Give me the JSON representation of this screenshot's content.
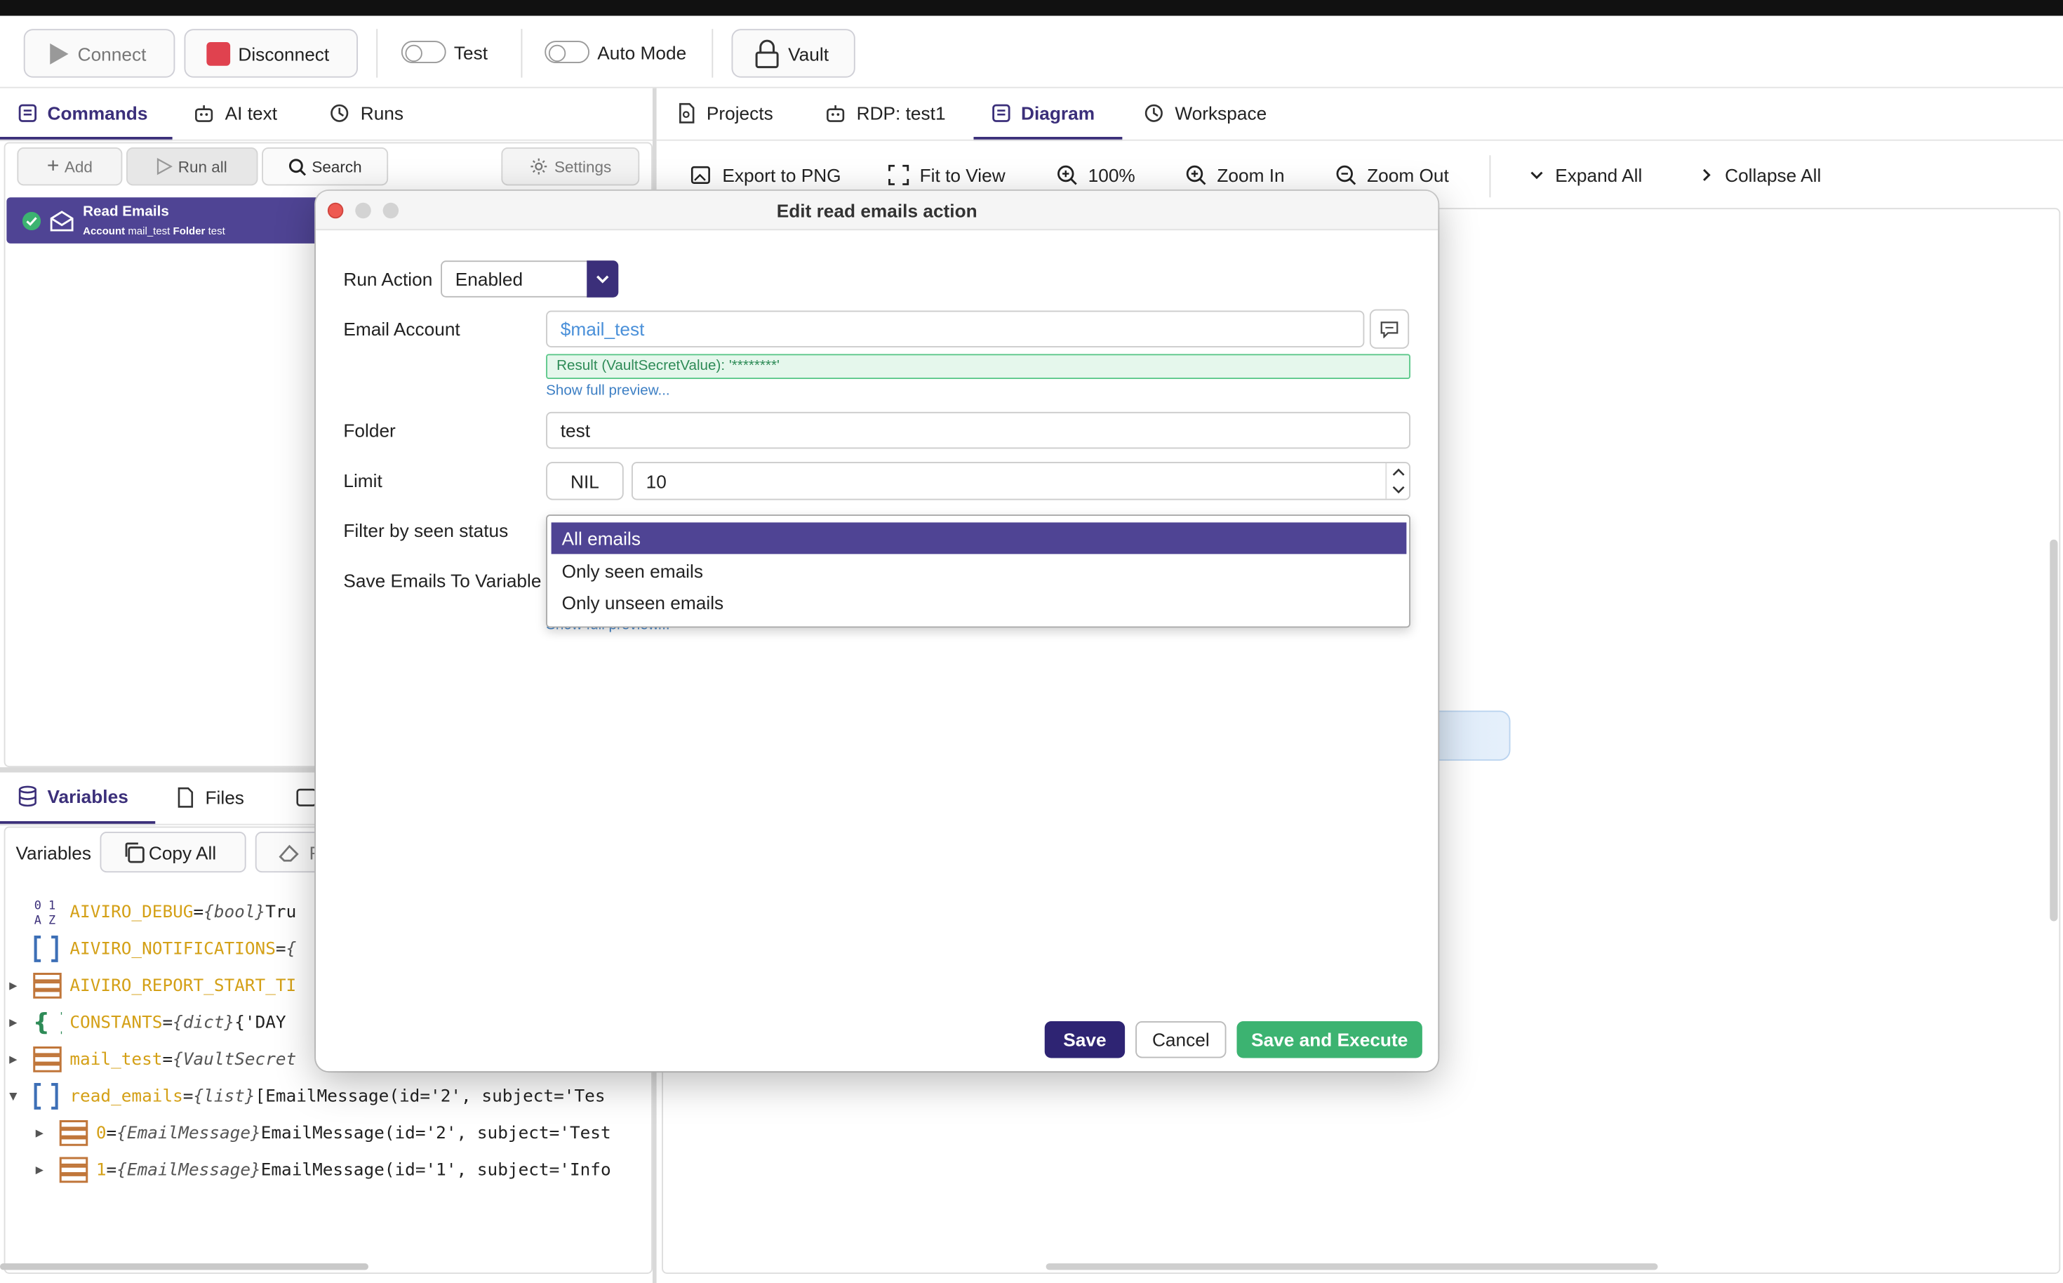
{
  "toolbar": {
    "connect": "Connect",
    "disconnect": "Disconnect",
    "test": "Test",
    "auto_mode": "Auto Mode",
    "vault": "Vault"
  },
  "left_tabs": {
    "commands": "Commands",
    "ai_text": "AI text",
    "runs": "Runs"
  },
  "commands_toolbar": {
    "add": "Add",
    "run_all": "Run all",
    "search": "Search",
    "settings": "Settings"
  },
  "command_item": {
    "title": "Read Emails",
    "account_key": "Account",
    "account_value": "mail_test",
    "folder_key": "Folder",
    "folder_value": "test"
  },
  "bottom_tabs": {
    "variables": "Variables",
    "files": "Files"
  },
  "variables_toolbar": {
    "label": "Variables",
    "copy_all": "Copy All",
    "reset_partial": "R"
  },
  "variables": [
    {
      "name": "AIVIRO_DEBUG",
      "eq": " = ",
      "type": "{bool}",
      "value": " Tru",
      "icon": "bool-icon"
    },
    {
      "name": "AIVIRO_NOTIFICATIONS",
      "eq": " = ",
      "type": "{",
      "value": "",
      "icon": "list-icon"
    },
    {
      "name": "AIVIRO_REPORT_START_TI",
      "eq": "",
      "type": "",
      "value": "",
      "icon": "object-icon"
    },
    {
      "name": "CONSTANTS",
      "eq": " = ",
      "type": "{dict}",
      "value": " {'DAY",
      "icon": "dict-icon"
    },
    {
      "name": "mail_test",
      "eq": " = ",
      "type": "{VaultSecret",
      "value": "",
      "icon": "object-icon"
    },
    {
      "name": "read_emails",
      "eq": " = ",
      "type": "{list}",
      "value": " [EmailMessage(id='2', subject='Tes",
      "icon": "list-icon"
    },
    {
      "name": "0",
      "eq": " = ",
      "type": "{EmailMessage}",
      "value": " EmailMessage(id='2', subject='Test",
      "icon": "object-icon"
    },
    {
      "name": "1",
      "eq": " = ",
      "type": "{EmailMessage}",
      "value": " EmailMessage(id='1', subject='Info",
      "icon": "object-icon"
    }
  ],
  "right_tabs": {
    "projects": "Projects",
    "rdp": "RDP: test1",
    "diagram": "Diagram",
    "workspace": "Workspace"
  },
  "diagram_toolbar": {
    "export": "Export to PNG",
    "fit": "Fit to View",
    "zoom_level": "100%",
    "zoom_in": "Zoom In",
    "zoom_out": "Zoom Out",
    "expand_all": "Expand All",
    "collapse_all": "Collapse All"
  },
  "modal": {
    "title": "Edit read emails action",
    "run_action_label": "Run Action",
    "run_action_value": "Enabled",
    "email_account_label": "Email Account",
    "email_account_value": "$mail_test",
    "result_text": "Result (VaultSecretValue): '********'",
    "show_full_preview": "Show full preview...",
    "folder_label": "Folder",
    "folder_value": "test",
    "limit_label": "Limit",
    "nil": "NIL",
    "limit_value": "10",
    "filter_label": "Filter by seen status",
    "save_var_label": "Save Emails To Variable",
    "show_full_preview_2": "Show full preview...",
    "options": [
      "All emails",
      "Only seen emails",
      "Only unseen emails"
    ],
    "save": "Save",
    "cancel": "Cancel",
    "save_execute": "Save and Execute"
  },
  "colors": {
    "accent": "#3b2f7a",
    "selection": "#4f4494",
    "green": "#3cb371",
    "red": "#e0424f",
    "link": "#3d7fc4"
  }
}
